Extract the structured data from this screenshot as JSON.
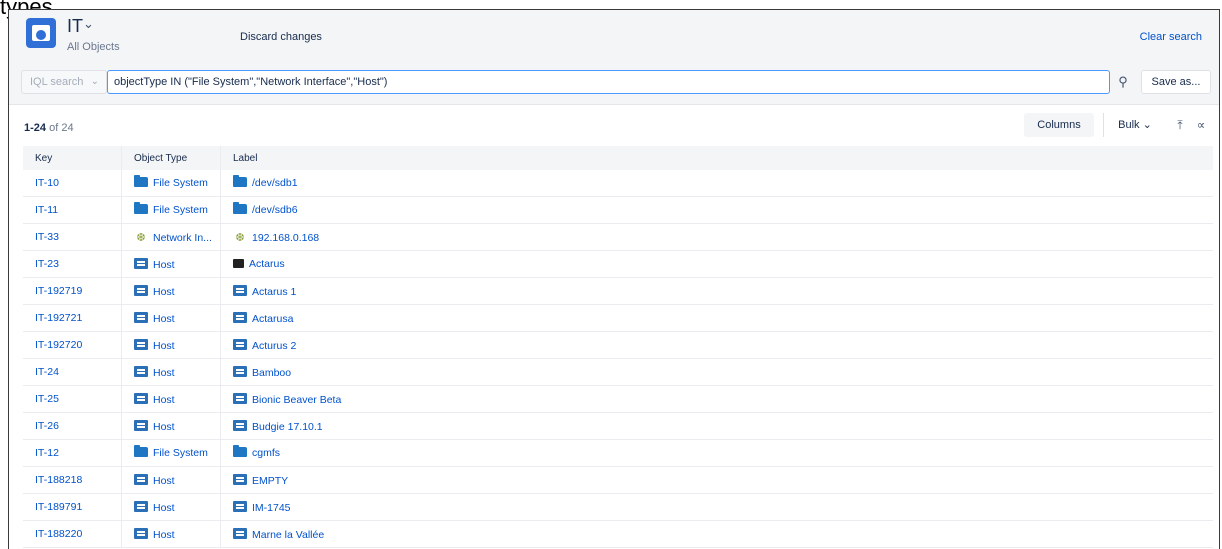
{
  "caption": "types.",
  "schema": {
    "name": "IT",
    "subtitle": "All Objects"
  },
  "header": {
    "discard_label": "Discard changes",
    "clear_search_label": "Clear search"
  },
  "search": {
    "mode_label": "IQL search",
    "query": "objectType IN (\"File System\",\"Network Interface\",\"Host\")",
    "save_as_label": "Save as..."
  },
  "results": {
    "range": "1-24",
    "of_text": "of 24"
  },
  "toolbar": {
    "columns_label": "Columns",
    "bulk_label": "Bulk"
  },
  "table": {
    "headers": {
      "key": "Key",
      "object_type": "Object Type",
      "label": "Label"
    },
    "rows": [
      {
        "key": "IT-10",
        "type": "File System",
        "type_icon": "folder-icon",
        "label": "/dev/sdb1",
        "label_icon": "folder-icon"
      },
      {
        "key": "IT-11",
        "type": "File System",
        "type_icon": "folder-icon",
        "label": "/dev/sdb6",
        "label_icon": "folder-icon"
      },
      {
        "key": "IT-33",
        "type": "Network In...",
        "type_icon": "network-icon",
        "label": "192.168.0.168",
        "label_icon": "network-icon"
      },
      {
        "key": "IT-23",
        "type": "Host",
        "type_icon": "host-icon",
        "label": "Actarus",
        "label_icon": "host-dark-icon"
      },
      {
        "key": "IT-192719",
        "type": "Host",
        "type_icon": "host-icon",
        "label": "Actarus 1",
        "label_icon": "host-icon"
      },
      {
        "key": "IT-192721",
        "type": "Host",
        "type_icon": "host-icon",
        "label": "Actarusa",
        "label_icon": "host-icon"
      },
      {
        "key": "IT-192720",
        "type": "Host",
        "type_icon": "host-icon",
        "label": "Acturus 2",
        "label_icon": "host-icon"
      },
      {
        "key": "IT-24",
        "type": "Host",
        "type_icon": "host-icon",
        "label": "Bamboo",
        "label_icon": "host-icon"
      },
      {
        "key": "IT-25",
        "type": "Host",
        "type_icon": "host-icon",
        "label": "Bionic Beaver Beta",
        "label_icon": "host-icon"
      },
      {
        "key": "IT-26",
        "type": "Host",
        "type_icon": "host-icon",
        "label": "Budgie 17.10.1",
        "label_icon": "host-icon"
      },
      {
        "key": "IT-12",
        "type": "File System",
        "type_icon": "folder-icon",
        "label": "cgmfs",
        "label_icon": "folder-icon"
      },
      {
        "key": "IT-188218",
        "type": "Host",
        "type_icon": "host-icon",
        "label": "EMPTY",
        "label_icon": "host-icon"
      },
      {
        "key": "IT-189791",
        "type": "Host",
        "type_icon": "host-icon",
        "label": "IM-1745",
        "label_icon": "host-icon"
      },
      {
        "key": "IT-188220",
        "type": "Host",
        "type_icon": "host-icon",
        "label": "Marne la Vallée",
        "label_icon": "host-icon"
      }
    ]
  },
  "colors": {
    "link": "#0052cc",
    "brand": "#2f6fd6",
    "focus": "#4c9aff",
    "bar_bg": "#f4f5f7"
  }
}
